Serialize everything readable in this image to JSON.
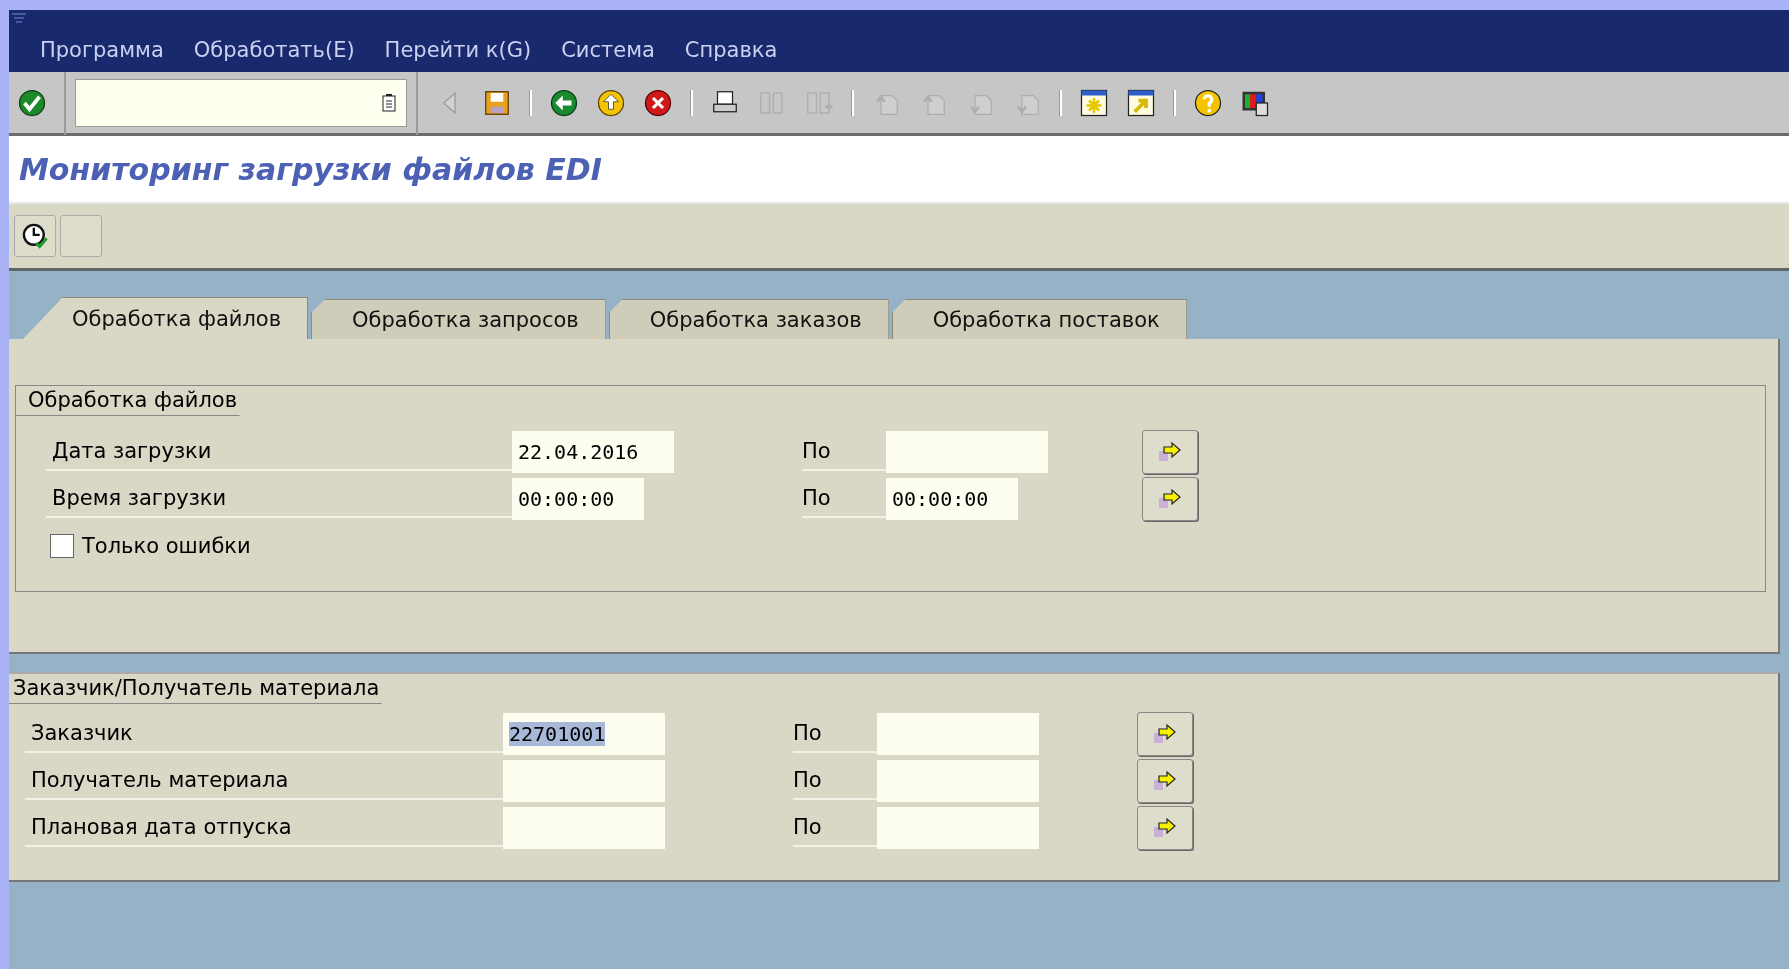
{
  "menu": [
    {
      "label": "Программа"
    },
    {
      "label": "Обработать(E)"
    },
    {
      "label": "Перейти к(G)"
    },
    {
      "label": "Система"
    },
    {
      "label": "Справка"
    }
  ],
  "toolbar": [
    {
      "kind": "enter",
      "disabled": false
    },
    {
      "kind": "command_field"
    },
    {
      "kind": "back_arrow",
      "disabled": true
    },
    {
      "kind": "save",
      "disabled": false
    },
    {
      "kind": "separator"
    },
    {
      "kind": "back",
      "disabled": false
    },
    {
      "kind": "exit",
      "disabled": false
    },
    {
      "kind": "cancel",
      "disabled": false
    },
    {
      "kind": "separator"
    },
    {
      "kind": "print",
      "disabled": false
    },
    {
      "kind": "find",
      "disabled": true
    },
    {
      "kind": "find_next",
      "disabled": true
    },
    {
      "kind": "separator"
    },
    {
      "kind": "first_page",
      "disabled": true
    },
    {
      "kind": "prev_page",
      "disabled": true
    },
    {
      "kind": "next_page",
      "disabled": true
    },
    {
      "kind": "last_page",
      "disabled": true
    },
    {
      "kind": "separator"
    },
    {
      "kind": "new_session",
      "disabled": false
    },
    {
      "kind": "shortcut",
      "disabled": false
    },
    {
      "kind": "separator"
    },
    {
      "kind": "help",
      "disabled": false
    },
    {
      "kind": "layout",
      "disabled": false
    }
  ],
  "window": {
    "title": "Мониторинг загрузки файлов EDI"
  },
  "app_toolbar": [
    {
      "kind": "execute"
    },
    {
      "kind": "blank"
    }
  ],
  "tabs": [
    {
      "label": "Обработка файлов",
      "selected": true
    },
    {
      "label": "Обработка запросов",
      "selected": false
    },
    {
      "label": "Обработка заказов",
      "selected": false
    },
    {
      "label": "Обработка поставок",
      "selected": false
    }
  ],
  "groups": [
    {
      "title": "Обработка файлов",
      "in_tab": true,
      "rows": [
        {
          "kind": "date_range",
          "label": "Дата загрузки",
          "from": "22.04.2016",
          "to_label": "По",
          "from_highlighted": false
        },
        {
          "kind": "time_range",
          "label": "Время загрузки",
          "from": "00:00:00",
          "to_label": "По",
          "to": "00:00:00",
          "from_highlighted": false
        },
        {
          "kind": "checkbox",
          "label": "Только ошибки",
          "checked": false
        }
      ]
    },
    {
      "title": "Заказчик/Получатель материала",
      "in_tab": false,
      "rows": [
        {
          "kind": "range",
          "label": "Заказчик",
          "from": "22701001",
          "to_label": "По",
          "from_highlighted": true
        },
        {
          "kind": "range",
          "label": "Получатель материала",
          "to_label": "По"
        },
        {
          "kind": "range",
          "label": "Плановая дата отпуска",
          "to_label": "По"
        }
      ]
    }
  ]
}
